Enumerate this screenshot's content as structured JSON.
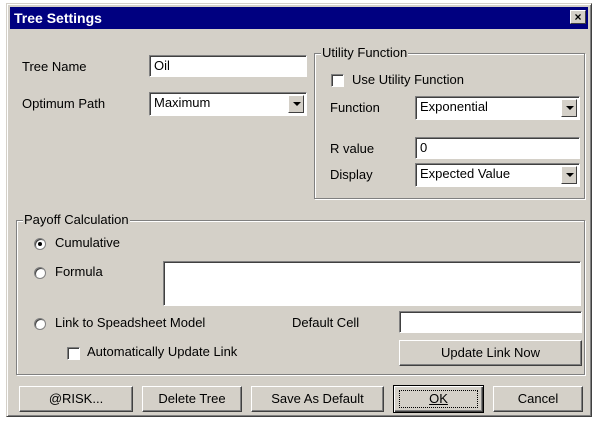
{
  "window": {
    "title": "Tree Settings",
    "close_glyph": "×"
  },
  "tree_name": {
    "label": "Tree Name",
    "value": "Oil"
  },
  "optimum_path": {
    "label": "Optimum Path",
    "value": "Maximum"
  },
  "utility_function": {
    "group_title": "Utility Function",
    "use_checkbox_label": "Use Utility Function",
    "use_checked": false,
    "function_label": "Function",
    "function_value": "Exponential",
    "r_value_label": "R value",
    "r_value": "0",
    "display_label": "Display",
    "display_value": "Expected Value"
  },
  "payoff": {
    "group_title": "Payoff Calculation",
    "cumulative_label": "Cumulative",
    "formula_label": "Formula",
    "formula_value": "",
    "link_label": "Link to Speadsheet Model",
    "selected": "cumulative",
    "default_cell_label": "Default Cell",
    "default_cell_value": "",
    "auto_update_label": "Automatically Update Link",
    "auto_update_checked": false,
    "update_link_button": "Update Link Now"
  },
  "buttons": {
    "risk": "@RISK...",
    "delete_tree": "Delete Tree",
    "save_default": "Save As Default",
    "ok": "OK",
    "cancel": "Cancel"
  },
  "icons": {
    "close": "close-icon",
    "dropdown": "chevron-down-icon"
  },
  "colors": {
    "titlebar": "#000080",
    "face": "#d4d0c8"
  }
}
